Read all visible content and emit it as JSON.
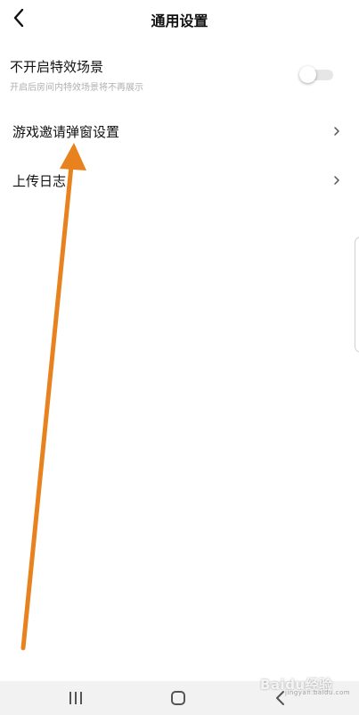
{
  "header": {
    "title": "通用设置",
    "back_icon": "chevron-left-icon"
  },
  "settings": {
    "special_effects": {
      "label": "不开启特效场景",
      "description": "开启后房间内特效场景将不再展示",
      "enabled": false
    },
    "game_invite_popup": {
      "label": "游戏邀请弹窗设置",
      "icon": "chevron-right-icon"
    },
    "upload_log": {
      "label": "上传日志",
      "icon": "chevron-right-icon"
    }
  },
  "annotation": {
    "color": "#e8821e",
    "icon": "arrow-up-icon"
  },
  "system_nav": {
    "recent_icon": "recent-apps-icon",
    "home_icon": "home-icon",
    "back_icon": "back-icon"
  },
  "watermark": {
    "text": "Baidu经验",
    "subtext": "jingyan.baidu.com"
  }
}
